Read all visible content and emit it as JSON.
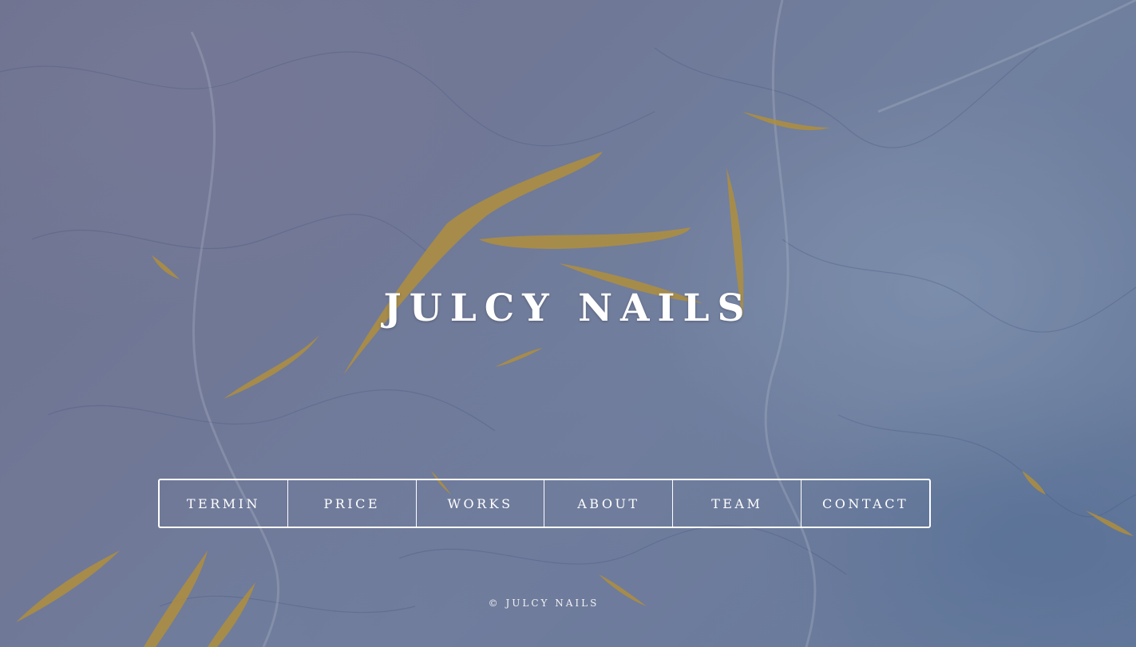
{
  "site": {
    "title": "JULCY NAILS"
  },
  "nav": {
    "items": [
      {
        "label": "TERMIN"
      },
      {
        "label": "PRICE"
      },
      {
        "label": "WORKS"
      },
      {
        "label": "ABOUT"
      },
      {
        "label": "TEAM"
      },
      {
        "label": "CONTACT"
      }
    ]
  },
  "footer": {
    "copyright": "© JULCY NAILS"
  },
  "colors": {
    "text": "#ffffff",
    "background_marble": "#7a86a8",
    "gold_veins": "#c9a13a"
  }
}
